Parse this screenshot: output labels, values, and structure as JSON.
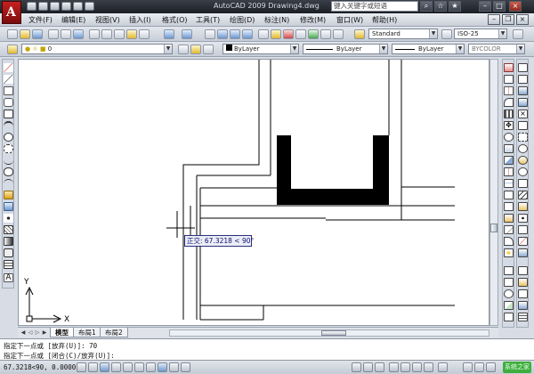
{
  "window": {
    "title": "AutoCAD 2009  Drawing4.dwg",
    "search_placeholder": "键入关键字或短语",
    "app_logo_letter": "A"
  },
  "menubar": {
    "items": [
      {
        "label": "文件(F)"
      },
      {
        "label": "编辑(E)"
      },
      {
        "label": "视图(V)"
      },
      {
        "label": "插入(I)"
      },
      {
        "label": "格式(O)"
      },
      {
        "label": "工具(T)"
      },
      {
        "label": "绘图(D)"
      },
      {
        "label": "标注(N)"
      },
      {
        "label": "修改(M)"
      },
      {
        "label": "窗口(W)"
      },
      {
        "label": "帮助(H)"
      }
    ]
  },
  "toolbar": {
    "text_style": "Standard",
    "dim_style": "ISO-25",
    "layer": "0",
    "color": "ByLayer",
    "linetype": "ByLayer",
    "lineweight": "ByLayer",
    "plot_style": "BYCOLOR"
  },
  "canvas": {
    "background_color": "#ffffff",
    "tooltip_text": "正交: 67.3218 < 90°",
    "ucs_x_label": "X",
    "ucs_y_label": "Y"
  },
  "tabs": {
    "items": [
      {
        "label": "模型",
        "active": true
      },
      {
        "label": "布局1",
        "active": false
      },
      {
        "label": "布局2",
        "active": false
      }
    ]
  },
  "command": {
    "lines": [
      "指定下一点或 [放弃(U)]: 70",
      "指定下一点或 [闭合(C)/放弃(U)]:"
    ]
  },
  "status": {
    "coordinates": "67.3218<90, 0.0000",
    "badge_text": "系统之家"
  }
}
